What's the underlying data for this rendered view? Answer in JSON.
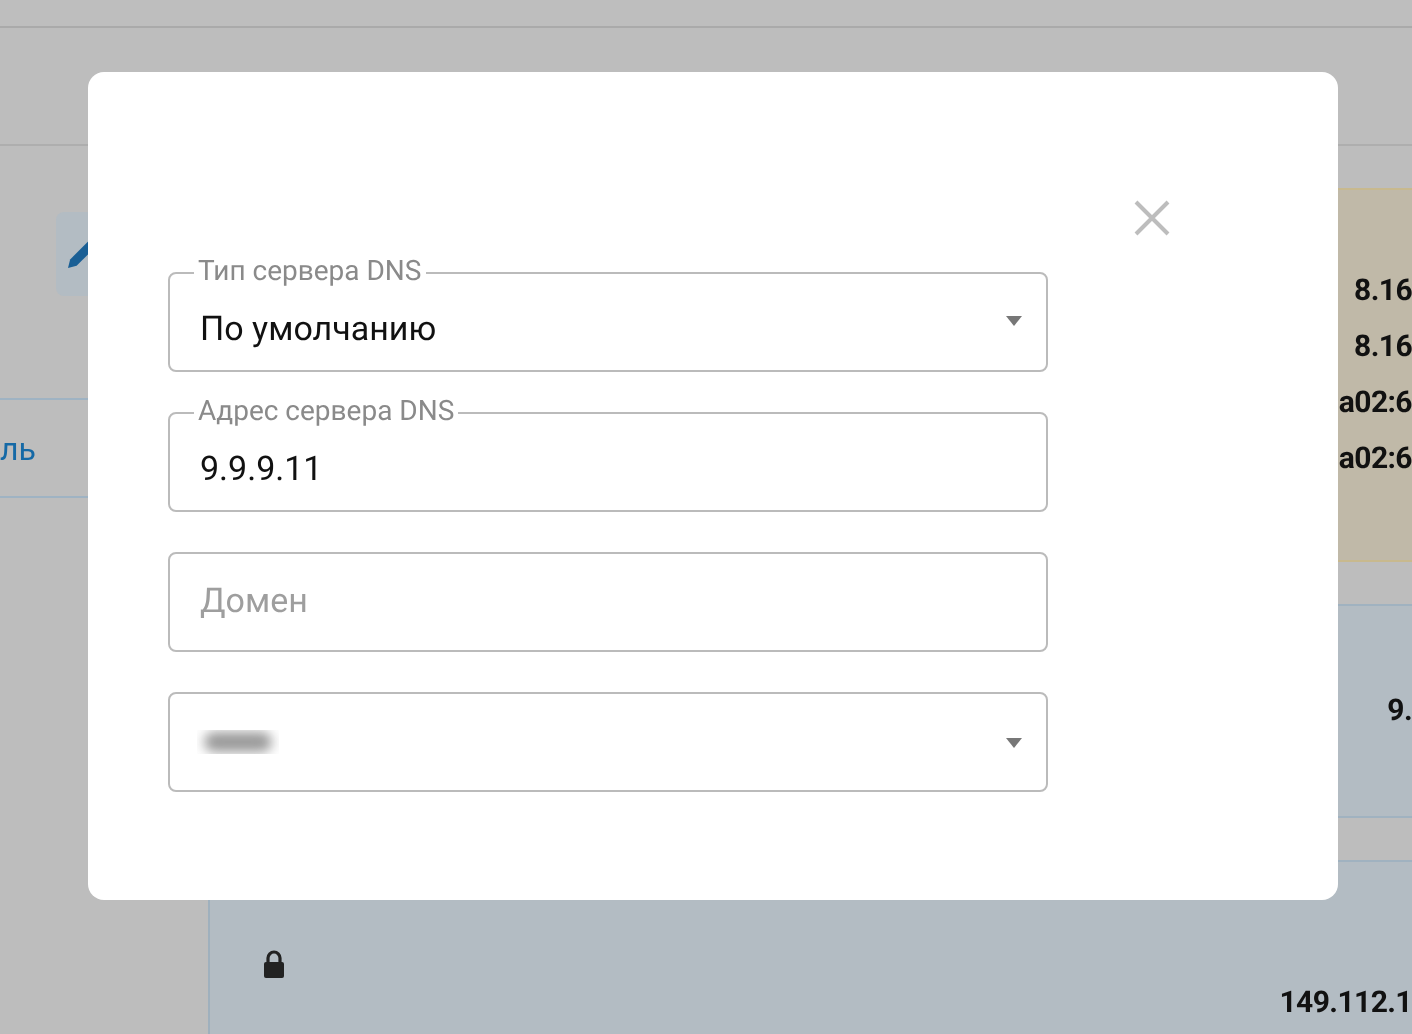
{
  "backdrop": {
    "link_text": "ль",
    "addresses": [
      "8.16",
      "8.16",
      "a02:6",
      "a02:6"
    ],
    "panel_value": "9.",
    "lower_value": "149.112.1"
  },
  "dialog": {
    "fields": [
      {
        "kind": "select",
        "label": "Тип сервера DNS",
        "value": "По умолчанию"
      },
      {
        "kind": "text",
        "label": "Адрес сервера DNS",
        "value": "9.9.9.11"
      },
      {
        "kind": "text",
        "placeholder": "Домен"
      },
      {
        "kind": "select",
        "redacted": true
      }
    ]
  }
}
